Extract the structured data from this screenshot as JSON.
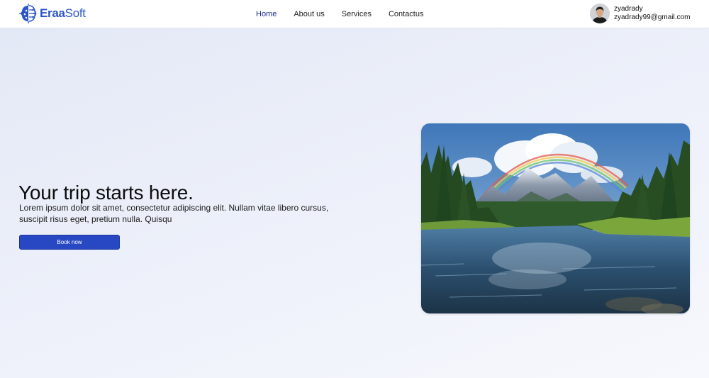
{
  "brand": {
    "name_bold": "Eraa",
    "name_light": "Soft",
    "logo_icon": "circuit-brain-icon",
    "color": "#2b55c4"
  },
  "nav": {
    "items": [
      {
        "label": "Home",
        "active": true
      },
      {
        "label": "About us",
        "active": false
      },
      {
        "label": "Services",
        "active": false
      },
      {
        "label": "Contactus",
        "active": false
      }
    ],
    "active_color": "#1a2a8c"
  },
  "user": {
    "name": "zyadrady",
    "email": "zyadrady99@gmail.com",
    "avatar_icon": "user-avatar-photo"
  },
  "hero": {
    "title": "Your trip starts here.",
    "description": "Lorem ipsum dolor sit amet, consectetur adipiscing elit. Nullam vitae libero cursus, suscipit risus eget, pretium nulla. Quisqu",
    "button_label": "Book now",
    "button_color": "#2748c2",
    "image_subject": "mountain-lake-rainbow-landscape"
  }
}
